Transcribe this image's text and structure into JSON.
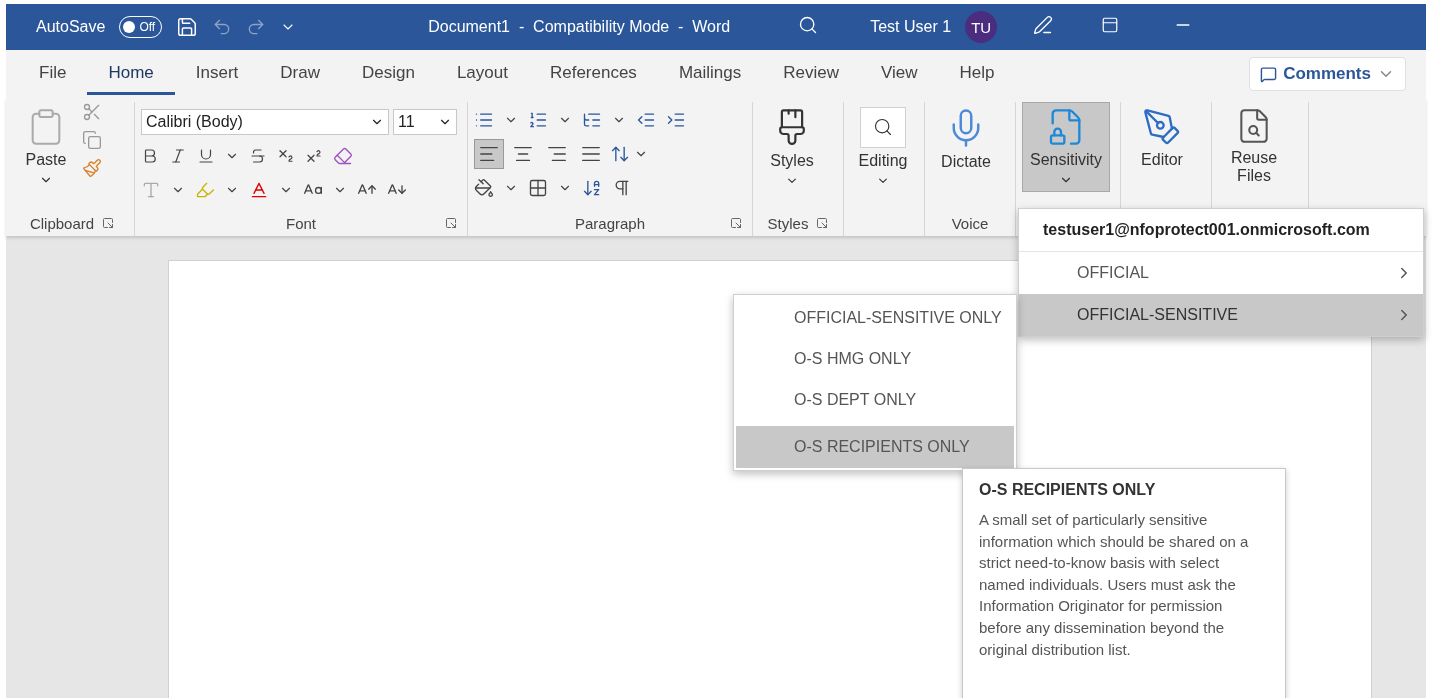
{
  "title_bar": {
    "autosave_label": "AutoSave",
    "autosave": {
      "label": "Off",
      "on": false
    },
    "title": "Document1  -  Compatibility Mode  -  Word",
    "user_name": "Test User 1",
    "avatar_initials": "TU"
  },
  "tabs": [
    {
      "label": "File",
      "selected": false
    },
    {
      "label": "Home",
      "selected": true
    },
    {
      "label": "Insert",
      "selected": false
    },
    {
      "label": "Draw",
      "selected": false
    },
    {
      "label": "Design",
      "selected": false
    },
    {
      "label": "Layout",
      "selected": false
    },
    {
      "label": "References",
      "selected": false
    },
    {
      "label": "Mailings",
      "selected": false
    },
    {
      "label": "Review",
      "selected": false
    },
    {
      "label": "View",
      "selected": false
    },
    {
      "label": "Help",
      "selected": false
    }
  ],
  "comments_button": "Comments",
  "ribbon": {
    "clipboard": {
      "paste": "Paste",
      "label": "Clipboard"
    },
    "font": {
      "name": "Calibri (Body)",
      "size": "11",
      "label": "Font"
    },
    "paragraph": {
      "label": "Paragraph",
      "alignment": [
        {
          "kind": "left",
          "selected": true
        },
        {
          "kind": "center",
          "selected": false
        },
        {
          "kind": "right",
          "selected": false
        },
        {
          "kind": "justify",
          "selected": false
        }
      ]
    },
    "styles": {
      "button": "Styles",
      "label": "Styles"
    },
    "editing": {
      "button": "Editing"
    },
    "voice": {
      "button": "Dictate",
      "label": "Voice"
    },
    "sensitivity": {
      "button": "Sensitivity",
      "selected": true
    },
    "editor": {
      "button": "Editor"
    },
    "reuse_files": {
      "button": "Reuse Files"
    }
  },
  "sensitivity_menu": {
    "account": "testuser1@nfoprotect001.onmicrosoft.com",
    "items": [
      {
        "label": "OFFICIAL",
        "selected": false
      },
      {
        "label": "OFFICIAL-SENSITIVE",
        "selected": true
      }
    ]
  },
  "submenu": {
    "items": [
      {
        "label": "OFFICIAL-SENSITIVE ONLY",
        "selected": false
      },
      {
        "label": "O-S HMG ONLY",
        "selected": false
      },
      {
        "label": "O-S DEPT ONLY",
        "selected": false
      },
      {
        "label": "O-S RECIPIENTS ONLY",
        "selected": true
      }
    ]
  },
  "tooltip": {
    "title": "O-S RECIPIENTS ONLY",
    "body": "A small set of particularly sensitive information which should be shared on a strict need-to-know basis with select named individuals. Users must ask the Information Originator for permission before any dissemination beyond the original distribution list."
  }
}
